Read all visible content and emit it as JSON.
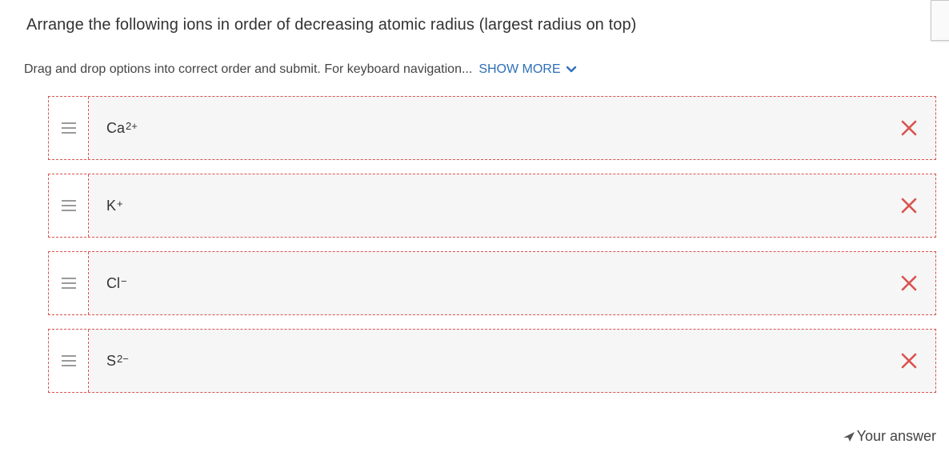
{
  "question": {
    "text": "Arrange the following ions in order of decreasing atomic radius (largest radius on top)"
  },
  "instructions": {
    "text": "Drag and drop options into correct order and submit. For keyboard navigation...",
    "show_more_label": "SHOW MORE",
    "show_more_icon": "chevron-down-icon"
  },
  "options": [
    {
      "base": "Ca",
      "charge": "2+",
      "status": "incorrect",
      "status_icon": "x-mark-icon"
    },
    {
      "base": "K",
      "charge": "+",
      "status": "incorrect",
      "status_icon": "x-mark-icon"
    },
    {
      "base": "Cl",
      "charge": "−",
      "status": "incorrect",
      "status_icon": "x-mark-icon"
    },
    {
      "base": "S",
      "charge": "2−",
      "status": "incorrect",
      "status_icon": "x-mark-icon"
    }
  ],
  "footer": {
    "your_answer_label": "Your answer",
    "your_answer_icon": "pointer-arrow-icon"
  },
  "colors": {
    "incorrect": "#d9534f",
    "link": "#2f6fb8",
    "option_bg": "#f6f6f6"
  }
}
